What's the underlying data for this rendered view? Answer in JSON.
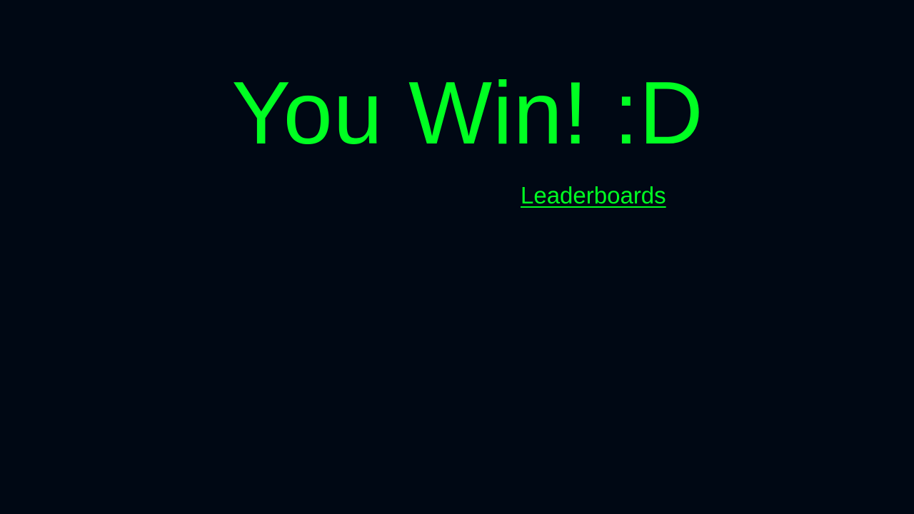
{
  "screen": {
    "title": "You Win! :D",
    "leaderboards_label": "Leaderboards"
  },
  "colors": {
    "background": "#000814",
    "text": "#00ff22"
  }
}
